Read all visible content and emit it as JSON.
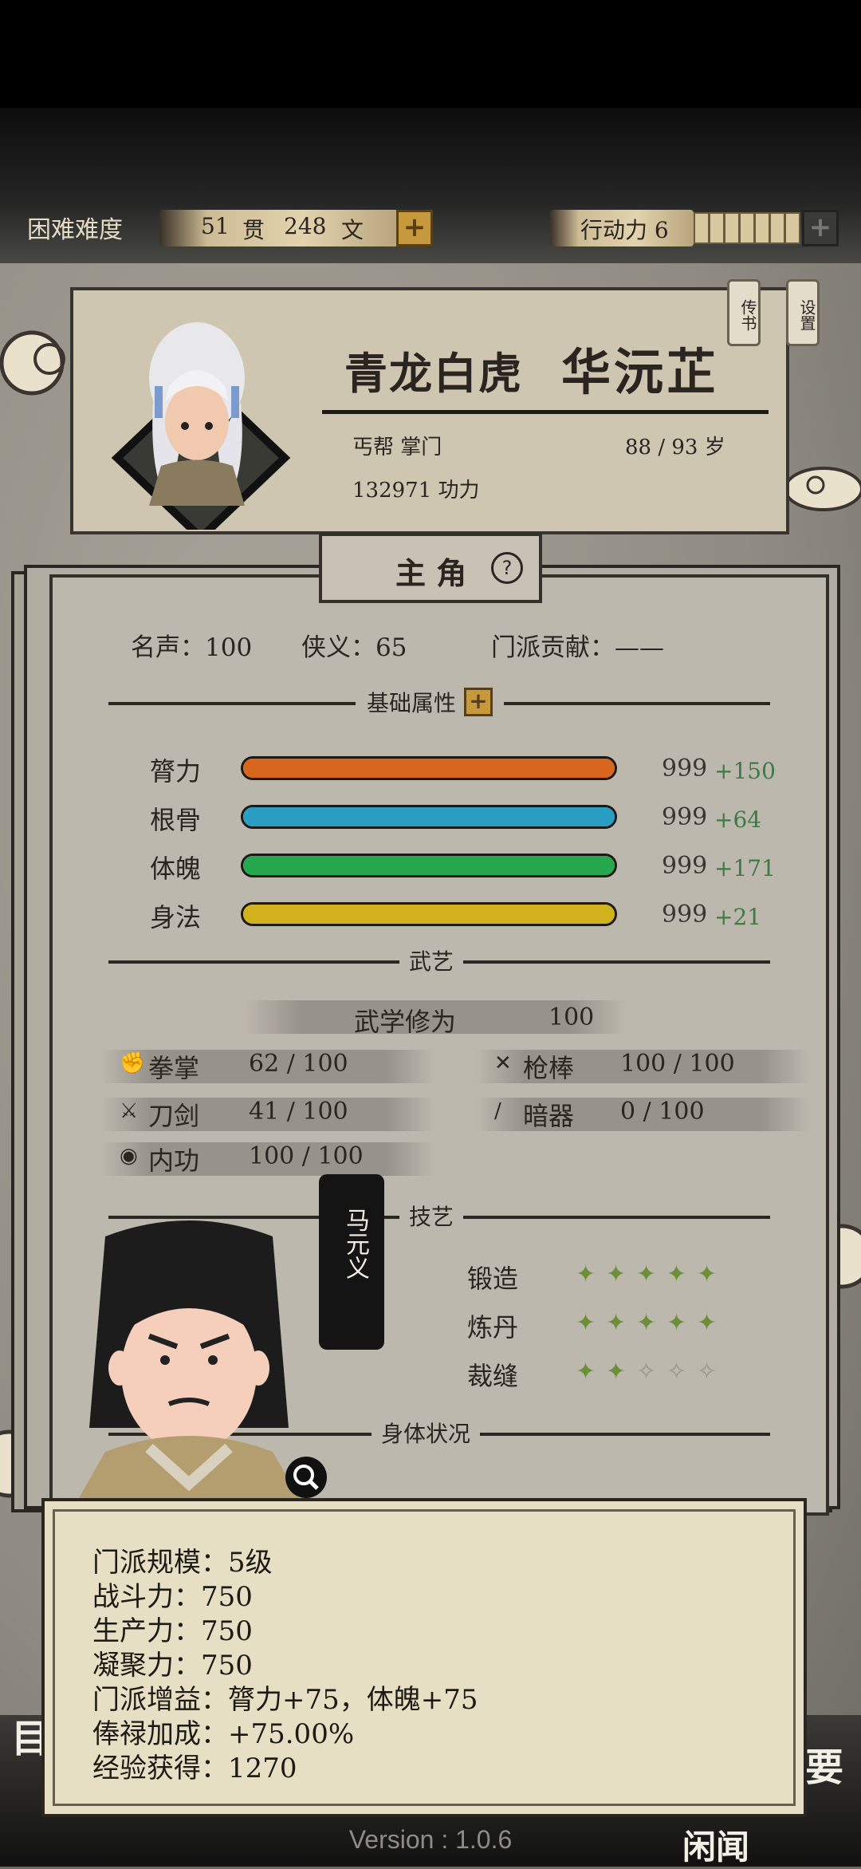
{
  "topbar": {
    "difficulty": "困难难度",
    "money_guan": "51",
    "money_guan_unit": "贯",
    "money_wen": "248",
    "money_wen_unit": "文",
    "action_label": "行动力 6",
    "action_filled": 7,
    "action_total": 7
  },
  "header": {
    "title": "青龙白虎",
    "name": "华沅芷",
    "sect_role": "丐帮 掌门",
    "age": "88 / 93 岁",
    "power": "132971 功力",
    "tab_chuanshu": "传书",
    "tab_shezhi": "设置"
  },
  "panel": {
    "tab_title": "主 角",
    "help": "?",
    "fame": "名声：100",
    "chivalry": "侠义：65",
    "contribution": "门派贡献：——"
  },
  "attributes": {
    "section": "基础属性",
    "items": [
      {
        "label": "膂力",
        "value": "999",
        "bonus": "+150",
        "color": "#d8661f",
        "fill": 1.0
      },
      {
        "label": "根骨",
        "value": "999",
        "bonus": "+64",
        "color": "#2a9dc2",
        "fill": 1.0
      },
      {
        "label": "体魄",
        "value": "999",
        "bonus": "+171",
        "color": "#27a84f",
        "fill": 1.0
      },
      {
        "label": "身法",
        "value": "999",
        "bonus": "+21",
        "color": "#d1b21c",
        "fill": 1.0
      }
    ]
  },
  "martial": {
    "section": "武艺",
    "cultivation_label": "武学修为",
    "cultivation_value": "100",
    "skills": [
      {
        "label": "拳掌",
        "value": "62 / 100",
        "icon": "fist-icon"
      },
      {
        "label": "枪棒",
        "value": "100 / 100",
        "icon": "spear-icon"
      },
      {
        "label": "刀剑",
        "value": "41 / 100",
        "icon": "sword-icon"
      },
      {
        "label": "暗器",
        "value": "0 / 100",
        "icon": "dart-icon"
      },
      {
        "label": "内功",
        "value": "100 / 100",
        "icon": "inner-energy-icon"
      }
    ]
  },
  "crafts": {
    "section": "技艺",
    "items": [
      {
        "label": "锻造",
        "level": 5,
        "max": 5
      },
      {
        "label": "炼丹",
        "level": 5,
        "max": 5
      },
      {
        "label": "裁缝",
        "level": 2,
        "max": 5
      }
    ]
  },
  "body": {
    "section": "身体状况"
  },
  "npc": {
    "name": "马元义"
  },
  "info": {
    "scale": "门派规模：5级",
    "combat": "战斗力：750",
    "production": "生产力：750",
    "cohesion": "凝聚力：750",
    "bonus": "门派增益：膂力+75，体魄+75",
    "salary": "俸禄加成：+75.00%",
    "exp": "经验获得：1270"
  },
  "footer": {
    "version": "Version : 1.0.6",
    "left_char": "目",
    "right_char": "要",
    "bottom_right": "闲闻"
  },
  "colors": {
    "accent_gold": "#c69a3c",
    "paper": "#cfc6b1",
    "bonus_green": "#3f7a45"
  }
}
